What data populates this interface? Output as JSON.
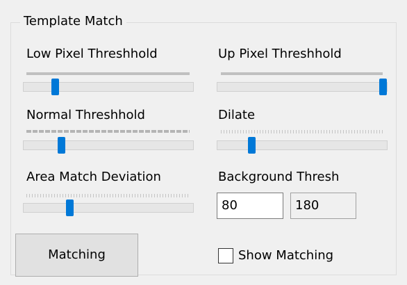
{
  "group_title": "Template Match",
  "sliders": {
    "low_pixel": {
      "label": "Low Pixel Threshhold",
      "level": 0.17
    },
    "up_pixel": {
      "label": "Up Pixel Threshhold",
      "level": 1.0
    },
    "normal": {
      "label": "Normal Threshhold",
      "level": 0.21
    },
    "dilate": {
      "label": "Dilate",
      "level": 0.19
    },
    "area_match": {
      "label": "Area Match Deviation",
      "level": 0.26
    }
  },
  "background_thresh": {
    "label": "Background Thresh",
    "value_low": "80",
    "value_high": "180"
  },
  "matching_button": "Matching",
  "show_matching": {
    "label": "Show Matching",
    "checked": false
  },
  "colors": {
    "accent": "#0078d7",
    "window_bg": "#f0f0f0"
  }
}
